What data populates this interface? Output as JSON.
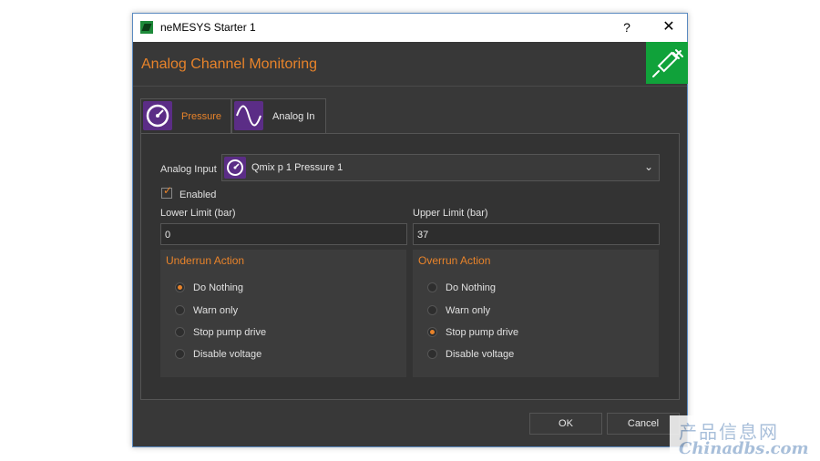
{
  "window": {
    "title": "neMESYS Starter 1",
    "help_glyph": "?",
    "close_glyph": "✕"
  },
  "header": {
    "title": "Analog Channel Monitoring",
    "icon": "syringe-icon"
  },
  "tabs": [
    {
      "label": "Pressure",
      "icon": "gauge-icon",
      "active": true
    },
    {
      "label": "Analog In",
      "icon": "sine-wave-icon",
      "active": false
    }
  ],
  "analog_input": {
    "label": "Analog Input",
    "value": "Qmix p 1 Pressure 1",
    "icon": "gauge-icon"
  },
  "enabled": {
    "label": "Enabled",
    "checked": true
  },
  "lower_limit": {
    "label": "Lower Limit (bar)",
    "value": "0"
  },
  "upper_limit": {
    "label": "Upper Limit (bar)",
    "value": "37"
  },
  "underrun": {
    "title": "Underrun Action",
    "options": [
      "Do Nothing",
      "Warn only",
      "Stop pump drive",
      "Disable voltage"
    ],
    "selected": "Do Nothing"
  },
  "overrun": {
    "title": "Overrun Action",
    "options": [
      "Do Nothing",
      "Warn only",
      "Stop pump drive",
      "Disable voltage"
    ],
    "selected": "Stop pump drive"
  },
  "buttons": {
    "ok": "OK",
    "cancel": "Cancel"
  },
  "watermark": {
    "line1": "产品信息网",
    "line2": "Chinadbs.com"
  },
  "colors": {
    "accent": "#e8832a",
    "background": "#383838",
    "icon_green": "#10a23a",
    "icon_purple": "#5b2d86"
  }
}
